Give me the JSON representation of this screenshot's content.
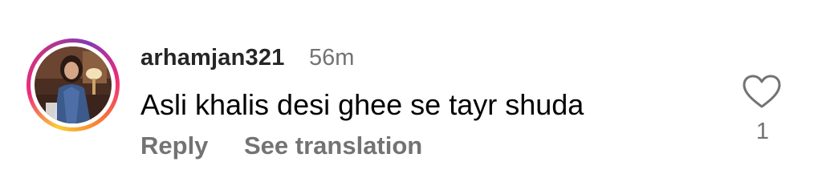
{
  "comment": {
    "username": "arhamjan321",
    "time_ago": "56m",
    "text": "Asli khalis desi ghee se tayr shuda",
    "actions": {
      "reply_label": "Reply",
      "translate_label": "See translation"
    },
    "like_icon": "heart-outline-icon",
    "like_count": "1"
  },
  "colors": {
    "username": "#262626",
    "secondary_text": "#737373",
    "story_ring": [
      "#f9ce34",
      "#ee2a7b",
      "#833ab4"
    ]
  }
}
